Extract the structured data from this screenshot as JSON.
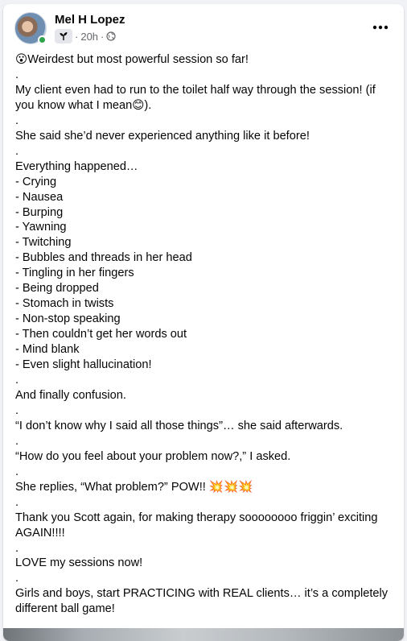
{
  "post": {
    "author": "Mel H Lopez",
    "time": "20h",
    "separator": "·",
    "audience_icon": "globe-icon",
    "badge_icon": "sprout-icon",
    "more_icon": "more-options-icon",
    "body_text": "😮Weirdest but most powerful session so far!\n.\nMy client even had to run to the toilet half way through the session! (if you know what I mean😊).\n.\nShe said she’d never experienced anything like it before!\n.\nEverything happened…\n- Crying\n- Nausea\n- Burping\n- Yawning\n- Twitching\n- Bubbles and threads in her head\n- Tingling in her fingers\n- Being dropped\n- Stomach in twists\n- Non-stop speaking\n- Then couldn’t get her words out\n- Mind blank\n- Even slight hallucination!\n.\nAnd finally confusion.\n.\n“I don’t know why I said all those things”… she said afterwards.\n.\n“How do you feel about your problem now?,” I asked.\n.\nShe replies, “What problem?” POW!! 💥💥💥\n.\nThank you Scott again, for making therapy soooooooo friggin’ exciting AGAIN!!!!\n.\nLOVE my sessions now!\n.\nGirls and boys, start PRACTICING with REAL clients… it’s a completely different ball game!"
  },
  "colors": {
    "online": "#31a24c",
    "secondary_text": "#65676b",
    "primary_text": "#050505",
    "card_bg": "#ffffff",
    "page_bg": "#f0f2f5"
  }
}
